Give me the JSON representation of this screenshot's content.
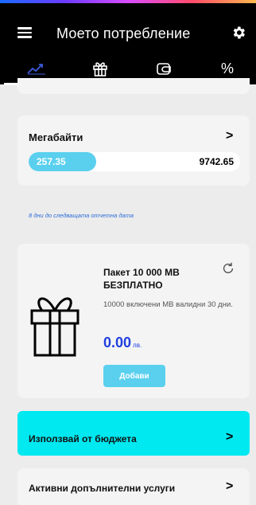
{
  "header": {
    "title": "Моето потребление",
    "menu_icon": "hamburger-menu-icon",
    "settings_icon": "gear-icon",
    "tabs": [
      {
        "icon": "trend-chart-icon",
        "active": true
      },
      {
        "icon": "gift-icon",
        "active": false
      },
      {
        "icon": "wallet-icon",
        "active": false
      },
      {
        "icon": "percent-icon",
        "active": false,
        "glyph": "%"
      }
    ]
  },
  "megabytes": {
    "title": "Мегабайти",
    "used": "257.35",
    "total": "9742.65",
    "used_fraction": 0.32
  },
  "days_note": "8 дни до следващата отчетна дата",
  "package": {
    "title": "Пакет 10 000 MB БЕЗПЛАТНО",
    "description": "10000 включени MB валидни 30 дни.",
    "price": "0.00",
    "currency": "лв.",
    "add_label": "Добави"
  },
  "budget": {
    "label": "Използвай от бюджета"
  },
  "services": {
    "label": "Активни допълнителни услуги"
  },
  "chevron": ">",
  "colors": {
    "accent": "#5ad0ee",
    "budget": "#00e8f0",
    "price": "#1f3fe0",
    "note": "#2b6cd8",
    "header": "#000000"
  }
}
